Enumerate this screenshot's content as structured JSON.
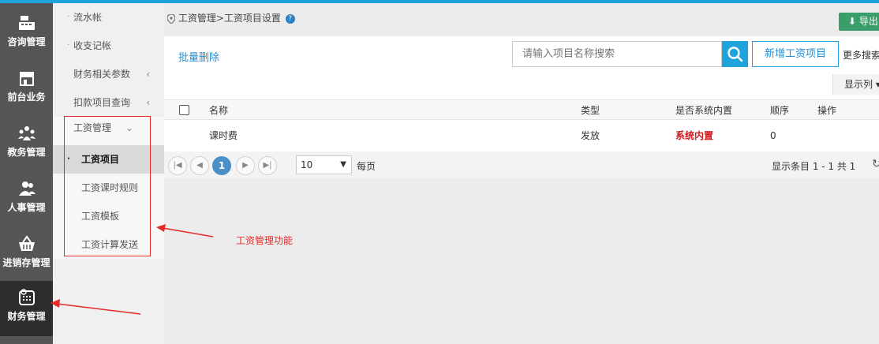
{
  "sidebar": {
    "items": [
      {
        "label": "咨询管理",
        "icon": "register-icon"
      },
      {
        "label": "前台业务",
        "icon": "storefront-icon"
      },
      {
        "label": "教务管理",
        "icon": "group-icon"
      },
      {
        "label": "人事管理",
        "icon": "users-icon"
      },
      {
        "label": "进销存管理",
        "icon": "basket-icon"
      },
      {
        "label": "财务管理",
        "icon": "calculator-icon",
        "active": true
      }
    ]
  },
  "submenu": {
    "items": [
      {
        "label": "流水帐"
      },
      {
        "label": "收支记帐"
      },
      {
        "label": "财务相关参数"
      },
      {
        "label": "扣款项目查询"
      }
    ],
    "group": {
      "label": "工资管理",
      "children": [
        {
          "label": "工资项目",
          "active": true
        },
        {
          "label": "工资课时规则"
        },
        {
          "label": "工资模板"
        },
        {
          "label": "工资计算发送"
        }
      ]
    }
  },
  "breadcrumb": {
    "text": "工资管理>工资项目设置",
    "help": "?"
  },
  "toolbar": {
    "export_label": "导出",
    "batch_delete_label": "批量删除",
    "search_placeholder": "请输入项目名称搜索",
    "add_label": "新增工资项目",
    "more_search_label": "更多搜索",
    "columns_label": "显示列"
  },
  "table": {
    "headers": [
      "名称",
      "类型",
      "是否系统内置",
      "顺序",
      "操作"
    ],
    "rows": [
      {
        "name": "课时费",
        "type": "发放",
        "system": "系统内置",
        "order": "0",
        "action": ""
      }
    ]
  },
  "pager": {
    "current_page": "1",
    "page_size": "10",
    "per_page_label": "每页",
    "info": "显示条目 1 - 1 共 1"
  },
  "annotation": {
    "text": "工资管理功能",
    "color": "#e62a2a"
  },
  "colors": {
    "accent": "#1fa3dd",
    "export": "#3a9e6a",
    "danger": "#d0191f"
  }
}
